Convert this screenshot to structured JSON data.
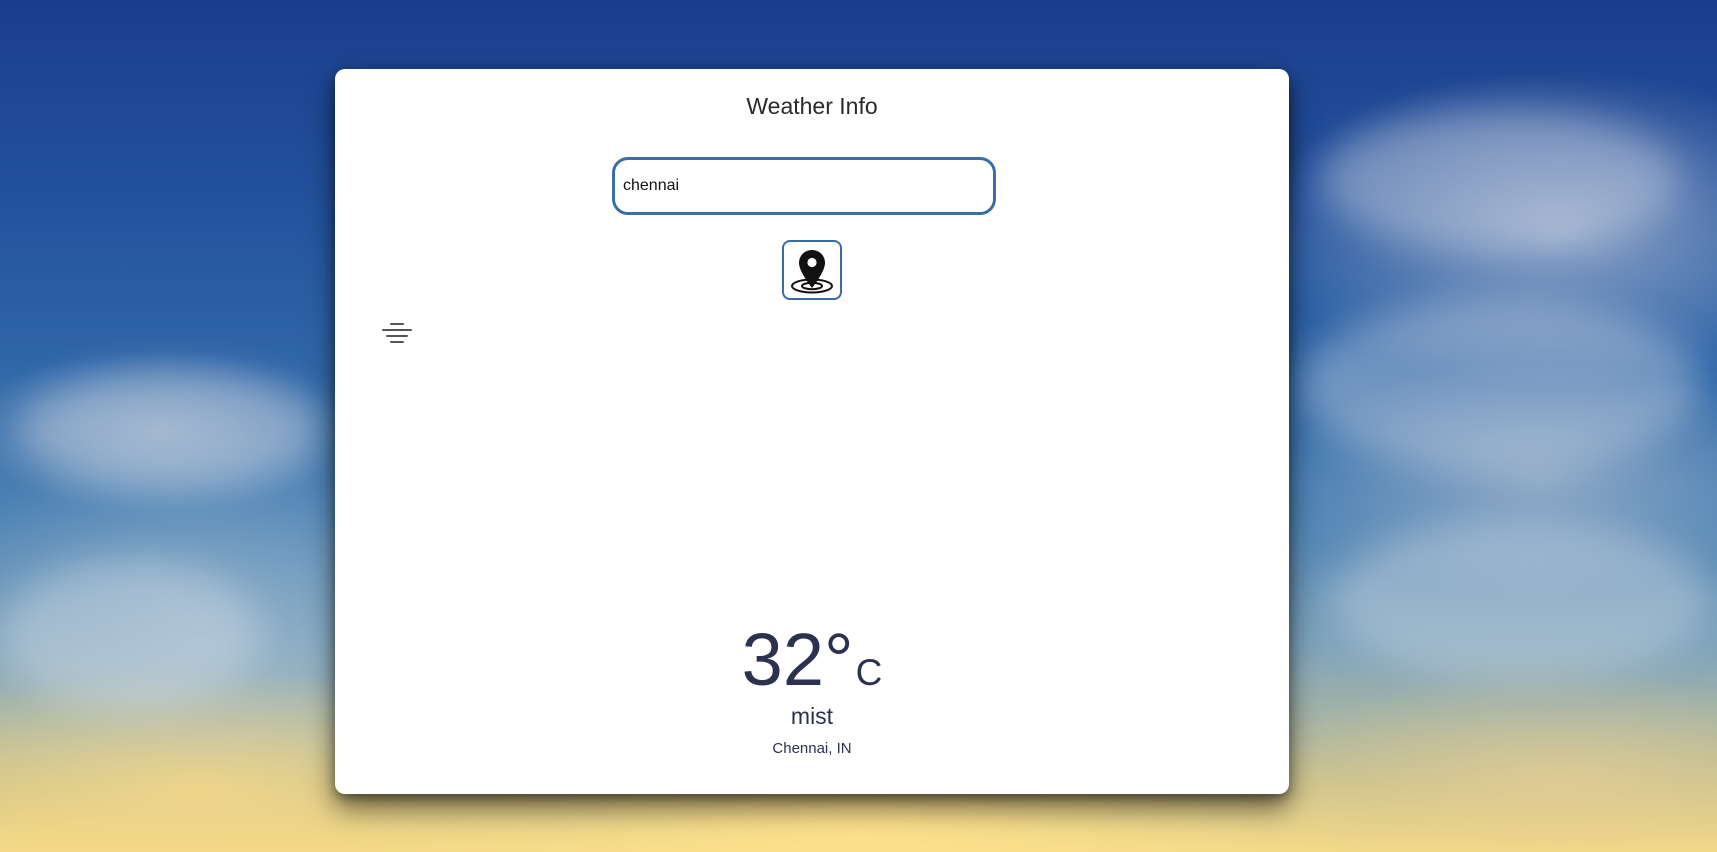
{
  "card": {
    "title": "Weather Info"
  },
  "search": {
    "value": "chennai",
    "placeholder": ""
  },
  "locate_button": {
    "icon": "location-pin-icon"
  },
  "weather": {
    "icon": "mist-icon",
    "temperature": "32°",
    "unit": "C",
    "description": "mist",
    "location": "Chennai, IN"
  },
  "colors": {
    "accent_border": "#3a6ea5",
    "text_dark": "#2c3150",
    "card_bg": "#ffffff"
  }
}
